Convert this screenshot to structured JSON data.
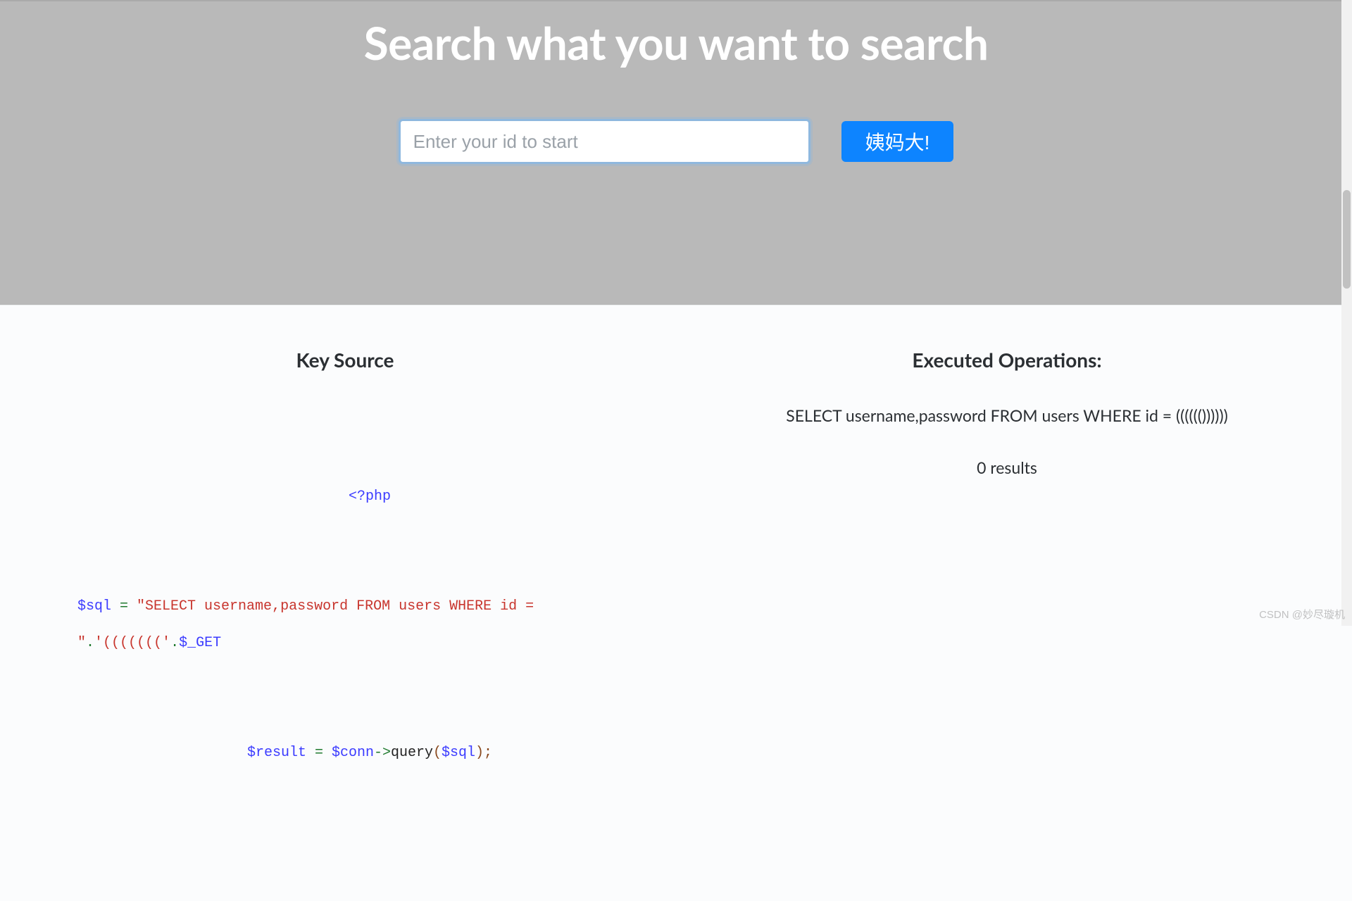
{
  "hero": {
    "title": "Search what you want to search",
    "input_placeholder": "Enter your id to start",
    "button_label": "姨妈大!"
  },
  "left": {
    "heading": "Key Source",
    "code_line1": "<?php",
    "code_l2_var": "$sql",
    "code_l2_eq": " = ",
    "code_l2_str": "\"SELECT username,password FROM users WHERE id = \"",
    "code_l2_dot": ".",
    "code_l2_str2": "'((((((('",
    "code_l2_dot2": ".",
    "code_l2_var2": "$_GET",
    "code_l3_var": "$result",
    "code_l3_eq": " = ",
    "code_l3_var2": "$conn",
    "code_l3_arrow": "->",
    "code_l3_fn": "query",
    "code_l3_open": "(",
    "code_l3_arg": "$sql",
    "code_l3_close": ");"
  },
  "right": {
    "heading": "Executed Operations:",
    "executed_sql": "SELECT username,password FROM users WHERE id = (((((())))))",
    "results": "0 results"
  },
  "watermark": "CSDN @妙尽璇机"
}
